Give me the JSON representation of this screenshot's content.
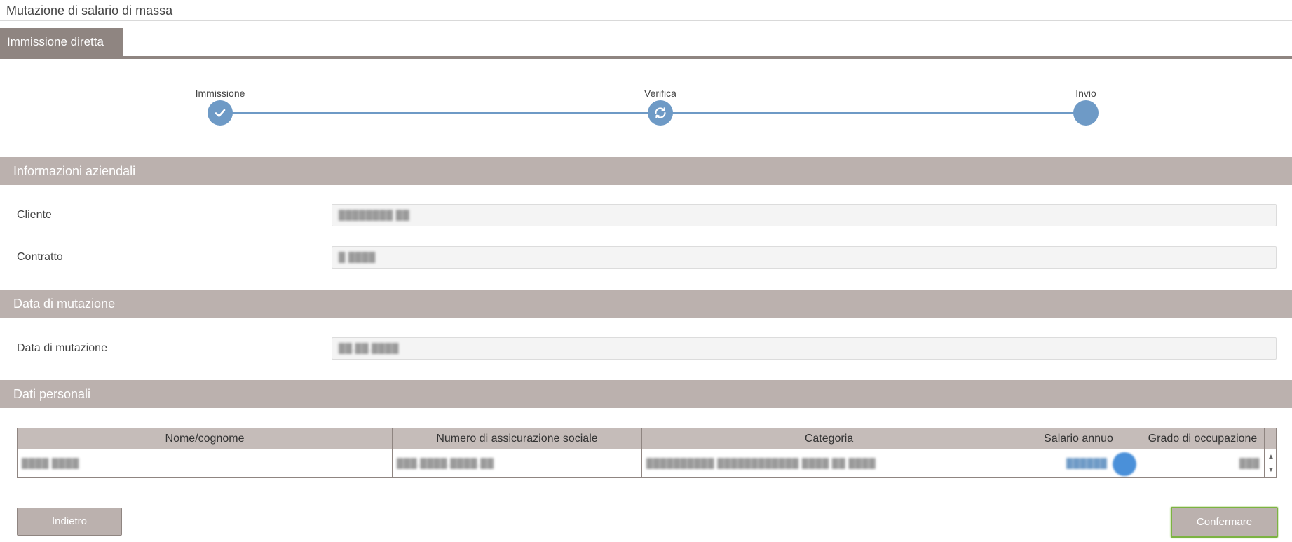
{
  "page": {
    "title": "Mutazione di salario di massa"
  },
  "tabs": [
    {
      "label": "Immissione diretta"
    }
  ],
  "stepper": {
    "steps": [
      {
        "label": "Immissione",
        "state": "done"
      },
      {
        "label": "Verifica",
        "state": "in-progress"
      },
      {
        "label": "Invio",
        "state": "pending"
      }
    ],
    "accent_color": "#6e9ac6"
  },
  "sections": {
    "company": {
      "title": "Informazioni aziendali",
      "client_label": "Cliente",
      "client_value": "████████ ██",
      "contract_label": "Contratto",
      "contract_value": "█ ████"
    },
    "mutation": {
      "title": "Data di mutazione",
      "date_label": "Data di mutazione",
      "date_value": "██.██.████"
    },
    "personal": {
      "title": "Dati personali",
      "columns": [
        "Nome/cognome",
        "Numero di assicurazione sociale",
        "Categoria",
        "Salario annuo",
        "Grado di occupazione"
      ],
      "rows": [
        {
          "name": "████ ████",
          "ssn": "███.████.████.██",
          "category": "██████████ ████████████ ████ ██ ████",
          "salary": "██████",
          "occupation": "███"
        }
      ]
    }
  },
  "buttons": {
    "back": "Indietro",
    "confirm": "Confermare"
  },
  "colors": {
    "section_bar": "#bbb1ae",
    "tab": "#8f8581",
    "confirm_highlight": "#7cb342"
  }
}
